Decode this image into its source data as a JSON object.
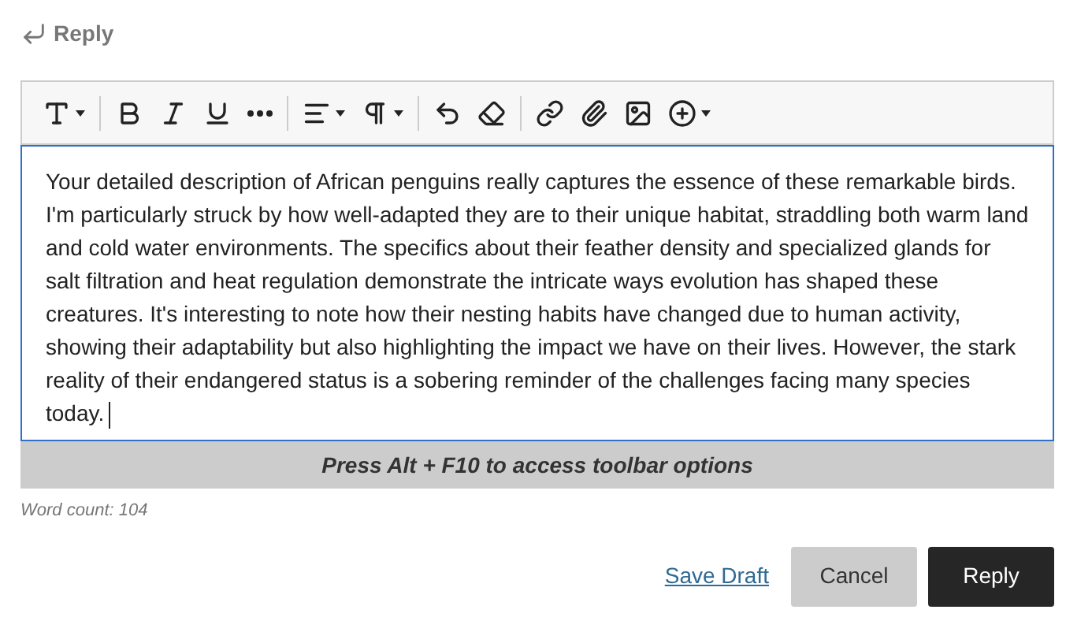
{
  "header": {
    "title": "Reply"
  },
  "toolbar": [
    {
      "kind": "tool",
      "has_menu": true
    },
    {
      "kind": "separator"
    },
    {
      "kind": "tool",
      "has_menu": false
    },
    {
      "kind": "tool",
      "has_menu": false
    },
    {
      "kind": "tool",
      "has_menu": false
    },
    {
      "kind": "tool",
      "has_menu": false
    },
    {
      "kind": "separator"
    },
    {
      "kind": "tool",
      "has_menu": true
    },
    {
      "kind": "tool",
      "has_menu": true
    },
    {
      "kind": "separator"
    },
    {
      "kind": "tool",
      "has_menu": false
    },
    {
      "kind": "tool",
      "has_menu": false
    },
    {
      "kind": "separator"
    },
    {
      "kind": "tool",
      "has_menu": false
    },
    {
      "kind": "tool",
      "has_menu": false
    },
    {
      "kind": "tool",
      "has_menu": false
    },
    {
      "kind": "tool",
      "has_menu": true
    }
  ],
  "editor": {
    "value": "Your detailed description of African penguins really captures the essence of these remarkable birds. I'm particularly struck by how well-adapted they are to their unique habitat, straddling both warm land and cold water environments. The specifics about their feather density and specialized glands for salt filtration and heat regulation demonstrate the intricate ways evolution has shaped these creatures. It's interesting to note how their nesting habits have changed due to human activity, showing their adaptability but also highlighting the impact we have on their lives. However, the stark reality of their endangered status is a sobering reminder of the challenges facing many species today.",
    "focused": true
  },
  "hint": "Press Alt + F10 to access toolbar options",
  "word_count": "Word count: 104",
  "actions": [
    {
      "kind": "link",
      "label": "Save Draft"
    },
    {
      "kind": "secondary",
      "label": "Cancel"
    },
    {
      "kind": "primary",
      "label": "Reply"
    }
  ]
}
